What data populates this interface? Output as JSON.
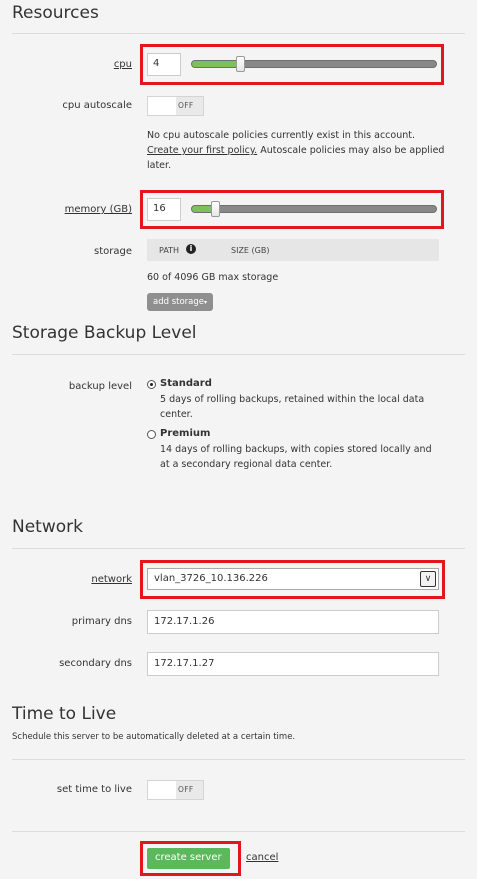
{
  "resources": {
    "title": "Resources",
    "cpu_label": "cpu",
    "cpu_value": "4",
    "cpu_slider_fraction": 0.2,
    "cpu_autoscale_label": "cpu autoscale",
    "cpu_autoscale_toggle": "OFF",
    "autoscale_note_line1": "No cpu autoscale policies currently exist in this account.",
    "autoscale_link": "Create your first policy.",
    "autoscale_note_rest_a": " Autoscale policies may also be applied",
    "autoscale_note_line3": "later.",
    "memory_label": "memory (GB)",
    "memory_value": "16",
    "memory_slider_fraction": 0.1,
    "storage_label": "storage",
    "storage_col_path": "PATH",
    "storage_col_size": "SIZE (GB)",
    "storage_info": "60 of 4096 GB max storage",
    "add_storage_button": "add storage"
  },
  "backup": {
    "title": "Storage Backup Level",
    "label": "backup level",
    "options": [
      {
        "title": "Standard",
        "desc_line1": "5 days of rolling backups, retained within the local data",
        "desc_line2": "center.",
        "selected": true
      },
      {
        "title": "Premium",
        "desc_line1": "14 days of rolling backups, with copies stored locally and",
        "desc_line2": "at a secondary regional data center.",
        "selected": false
      }
    ]
  },
  "network": {
    "title": "Network",
    "network_label": "network",
    "network_value": "vlan_3726_10.136.226",
    "primary_dns_label": "primary dns",
    "primary_dns_value": "172.17.1.26",
    "secondary_dns_label": "secondary dns",
    "secondary_dns_value": "172.17.1.27"
  },
  "ttl": {
    "title": "Time to Live",
    "description": "Schedule this server to be automatically deleted at a certain time.",
    "label": "set time to live",
    "toggle": "OFF"
  },
  "actions": {
    "create_button": "create server",
    "cancel_link": "cancel"
  },
  "colors": {
    "accent_green": "#5cb85c",
    "slider_green": "#7dc15a",
    "highlight_red": "#e3161b"
  },
  "icons": {
    "info": "info-circle-icon",
    "caret": "caret-down-icon",
    "select_arrow": "chevron-down-icon"
  }
}
